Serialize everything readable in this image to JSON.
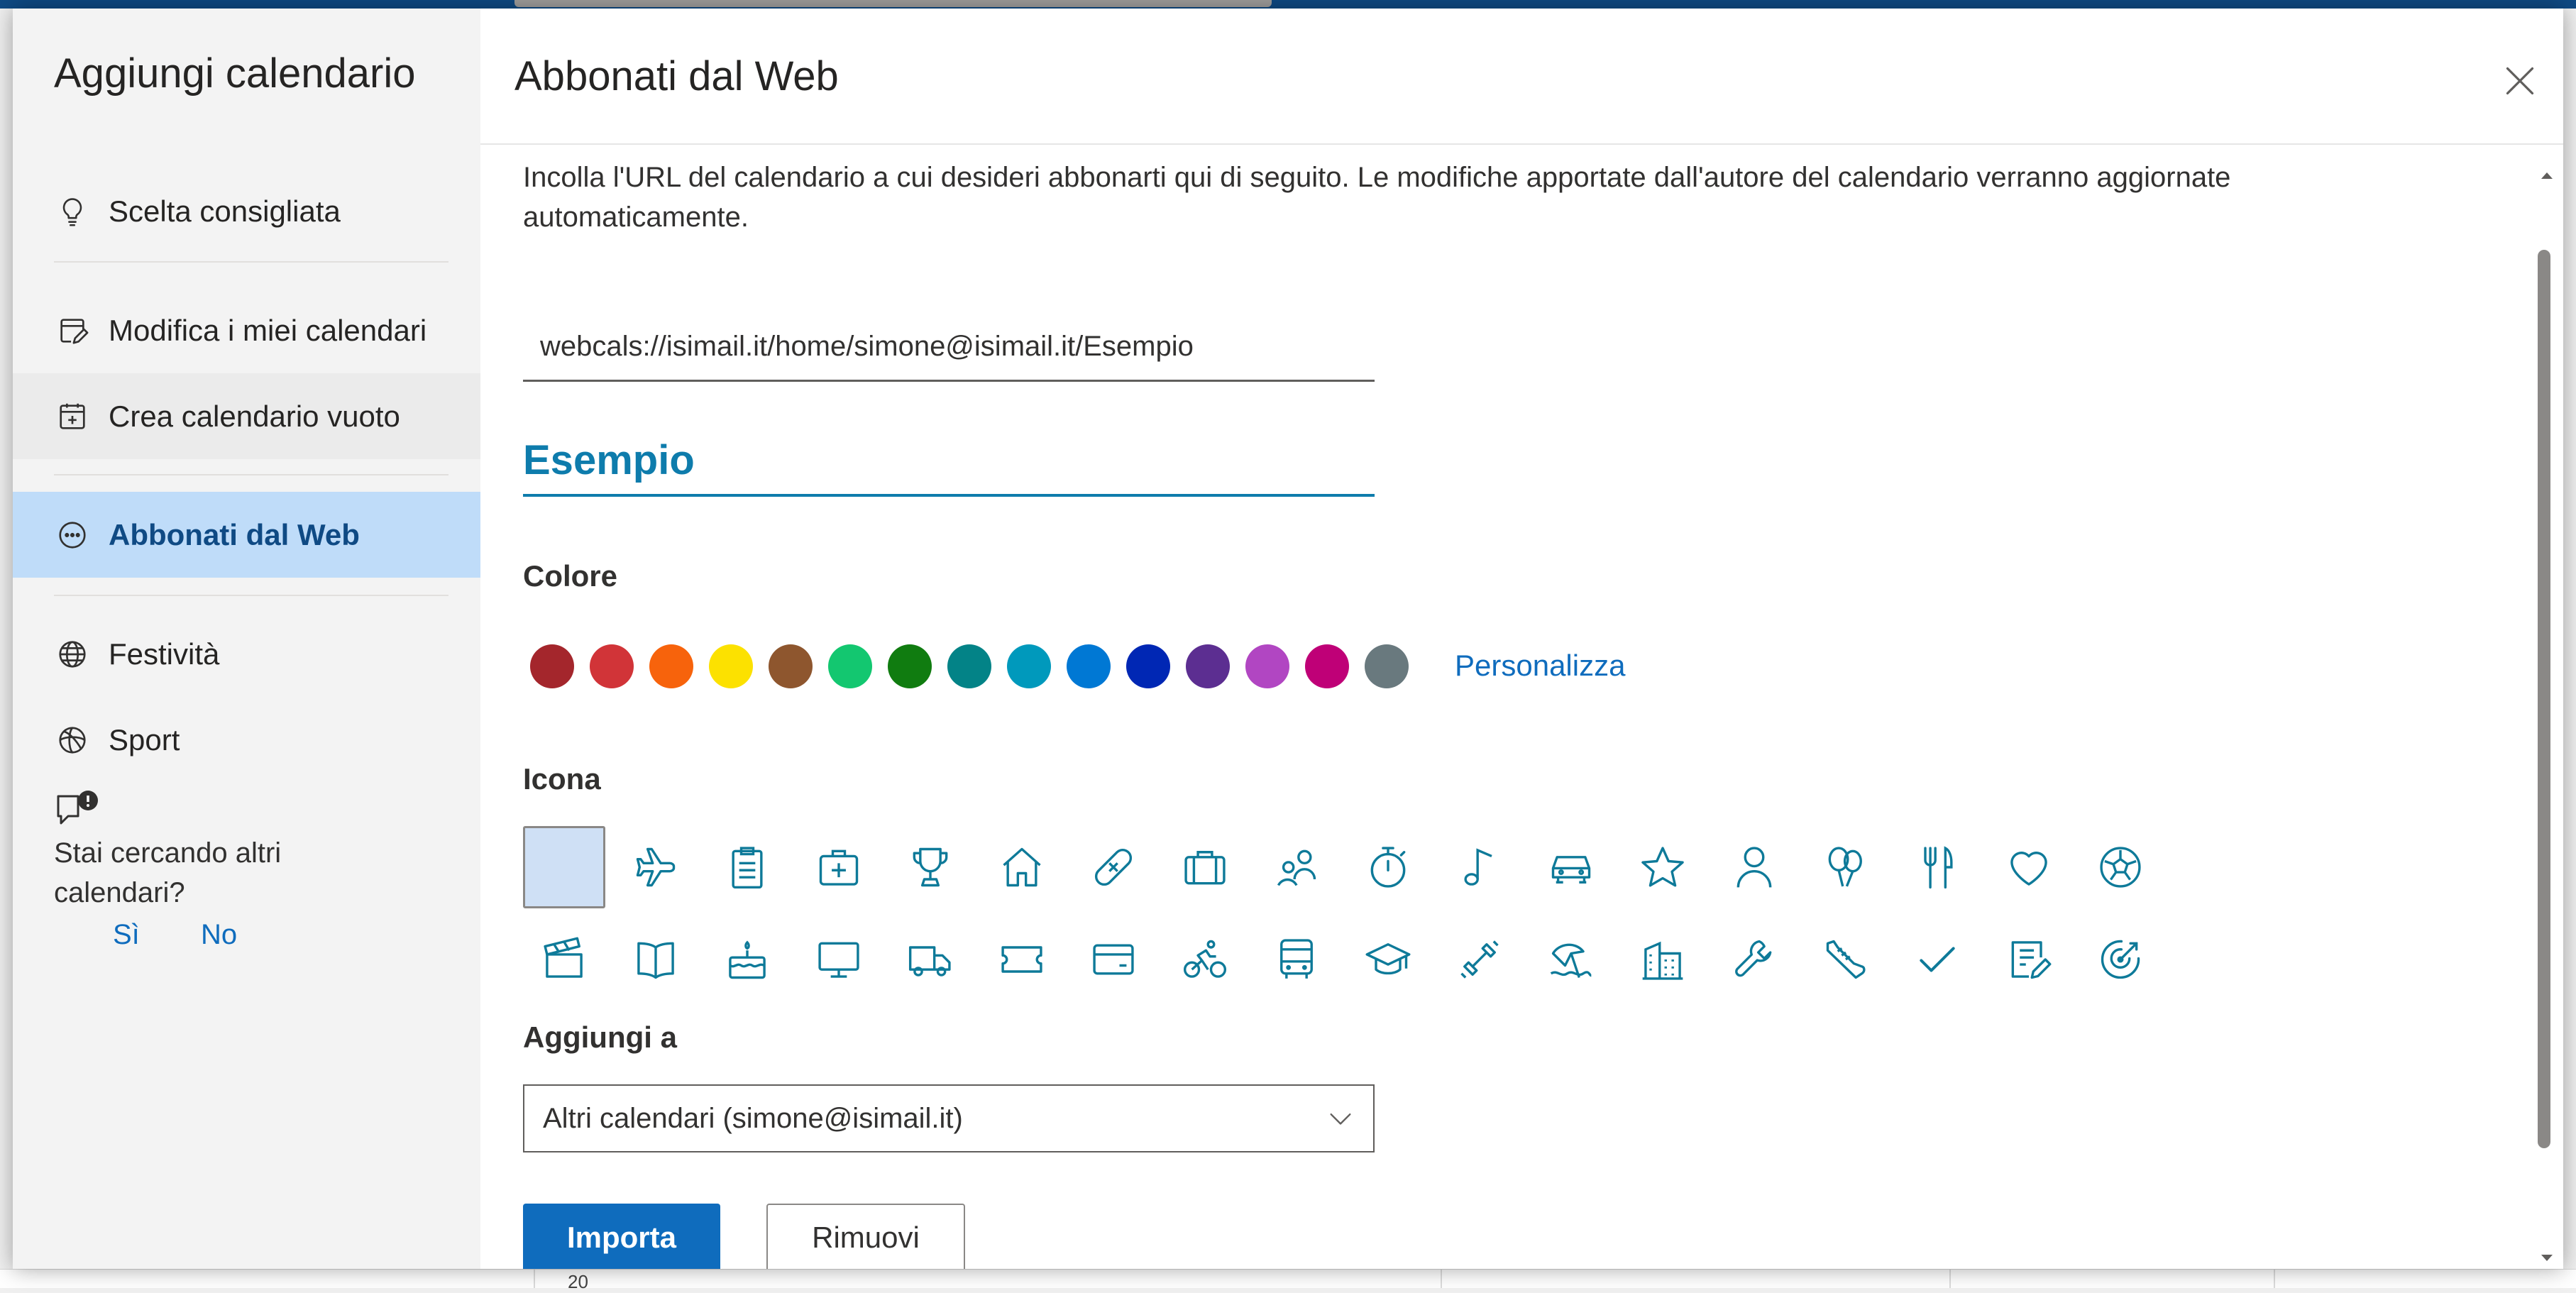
{
  "sidebar": {
    "title": "Aggiungi calendario",
    "items": [
      {
        "label": "Scelta consigliata",
        "icon": "lightbulb-icon"
      },
      {
        "label": "Modifica i miei calendari",
        "icon": "calendar-edit-icon"
      },
      {
        "label": "Crea calendario vuoto",
        "icon": "calendar-add-icon"
      },
      {
        "label": "Abbonati dal Web",
        "icon": "web-subscribe-icon"
      },
      {
        "label": "Festività",
        "icon": "globe-icon"
      },
      {
        "label": "Sport",
        "icon": "sports-ball-icon"
      }
    ],
    "feedback": {
      "question": "Stai cercando altri calendari?",
      "yes": "Sì",
      "no": "No"
    }
  },
  "main": {
    "title": "Abbonati dal Web",
    "description": "Incolla l'URL del calendario a cui desideri abbonarti qui di seguito. Le modifiche apportate dall'autore del calendario verranno aggiornate automaticamente.",
    "url_value": "webcals://isimail.it/home/simone@isimail.it/Esempio",
    "name_value": "Esempio",
    "color_label": "Colore",
    "colors": [
      "#a4262c",
      "#d13438",
      "#f7630c",
      "#fce100",
      "#8e562e",
      "#13c770",
      "#107c10",
      "#038387",
      "#0099bc",
      "#0078d4",
      "#0027b4",
      "#5c2e91",
      "#b146c2",
      "#bf0077",
      "#69797e"
    ],
    "customize_label": "Personalizza",
    "icon_label": "Icona",
    "icons_row1": [
      "none-icon",
      "airplane-icon",
      "clipboard-icon",
      "medical-kit-icon",
      "trophy-icon",
      "home-icon",
      "bandage-icon",
      "briefcase-icon",
      "people-icon",
      "stopwatch-icon",
      "music-note-icon",
      "car-icon",
      "star-icon",
      "person-icon",
      "balloons-icon",
      "fork-knife-icon",
      "heart-icon",
      "soccer-ball-icon"
    ],
    "icons_row2": [
      "clapperboard-icon",
      "book-icon",
      "birthday-cake-icon",
      "monitor-icon",
      "truck-icon",
      "ticket-icon",
      "credit-card-icon",
      "cyclist-icon",
      "bus-icon",
      "graduation-cap-icon",
      "dumbbell-icon",
      "beach-icon",
      "building-icon",
      "wrench-icon",
      "sneaker-icon",
      "checkmark-icon",
      "notepad-icon",
      "target-icon"
    ],
    "add_to_label": "Aggiungi a",
    "add_to_value": "Altri calendari (simone@isimail.it)",
    "import_label": "Importa",
    "remove_label": "Rimuovi"
  },
  "background": {
    "day_number": "20"
  }
}
